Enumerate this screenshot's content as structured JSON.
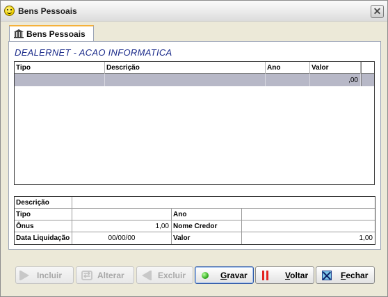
{
  "window": {
    "title": "Bens Pessoais"
  },
  "tab": {
    "label": "Bens Pessoais"
  },
  "company": "DEALERNET - ACAO INFORMATICA",
  "grid": {
    "columns": [
      "Tipo",
      "Descrição",
      "Ano",
      "Valor"
    ],
    "rows": [
      {
        "tipo": "",
        "descricao": "",
        "ano": "",
        "valor": ",00"
      }
    ]
  },
  "detail": {
    "descricao_label": "Descrição",
    "descricao_value": "",
    "tipo_label": "Tipo",
    "tipo_value": "",
    "ano_label": "Ano",
    "ano_value": "",
    "onus_label": "Ônus",
    "onus_value": "1,00",
    "nome_credor_label": "Nome Credor",
    "nome_credor_value": "",
    "data_liquidacao_label": "Data Liquidação",
    "data_liquidacao_value": "00/00/00",
    "valor_label": "Valor",
    "valor_value": "1,00"
  },
  "buttons": {
    "incluir": {
      "label": "Incluir",
      "enabled": false
    },
    "alterar": {
      "label": "Alterar",
      "enabled": false
    },
    "excluir": {
      "label": "Excluir",
      "enabled": false
    },
    "gravar": {
      "first": "G",
      "rest": "ravar",
      "enabled": true
    },
    "voltar": {
      "first": "V",
      "rest": "oltar",
      "enabled": true
    },
    "fechar": {
      "first": "F",
      "rest": "echar",
      "enabled": true
    }
  }
}
